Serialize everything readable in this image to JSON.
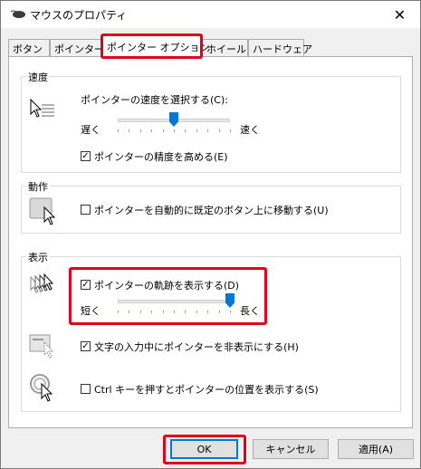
{
  "window": {
    "title": "マウスのプロパティ",
    "close_glyph": "✕"
  },
  "tabs": [
    {
      "label": "ボタン"
    },
    {
      "label": "ポインター"
    },
    {
      "label": "ポインター オプション"
    },
    {
      "label": "ホイール"
    },
    {
      "label": "ハードウェア"
    }
  ],
  "active_tab": "ポインター オプション",
  "speed": {
    "title": "速度",
    "select_label": "ポインターの速度を選択する(C):",
    "slow": "遅く",
    "fast": "速く",
    "slider_value": 0.5,
    "precision_label": "ポインターの精度を高める(E)",
    "precision_checked": true
  },
  "motion": {
    "title": "動作",
    "snap_label": "ポインターを自動的に既定のボタン上に移動する(U)",
    "snap_checked": false
  },
  "visibility": {
    "title": "表示",
    "trails_label": "ポインターの軌跡を表示する(D)",
    "trails_checked": true,
    "short": "短く",
    "long": "長く",
    "trails_value": 1.0,
    "hide_label": "文字の入力中にポインターを非表示にする(H)",
    "hide_checked": true,
    "ctrl_label": "Ctrl キーを押すとポインターの位置を表示する(S)",
    "ctrl_checked": false
  },
  "buttons": {
    "ok": "OK",
    "cancel": "キャンセル",
    "apply": "適用(A)"
  },
  "colors": {
    "accent": "#0078d7",
    "highlight": "#e0001b"
  },
  "icons": [
    "mouse-icon",
    "close-icon",
    "pointer-speed-icon",
    "snap-to-icon",
    "pointer-trails-icon",
    "hide-pointer-icon",
    "ctrl-locate-icon",
    "check-icon"
  ]
}
